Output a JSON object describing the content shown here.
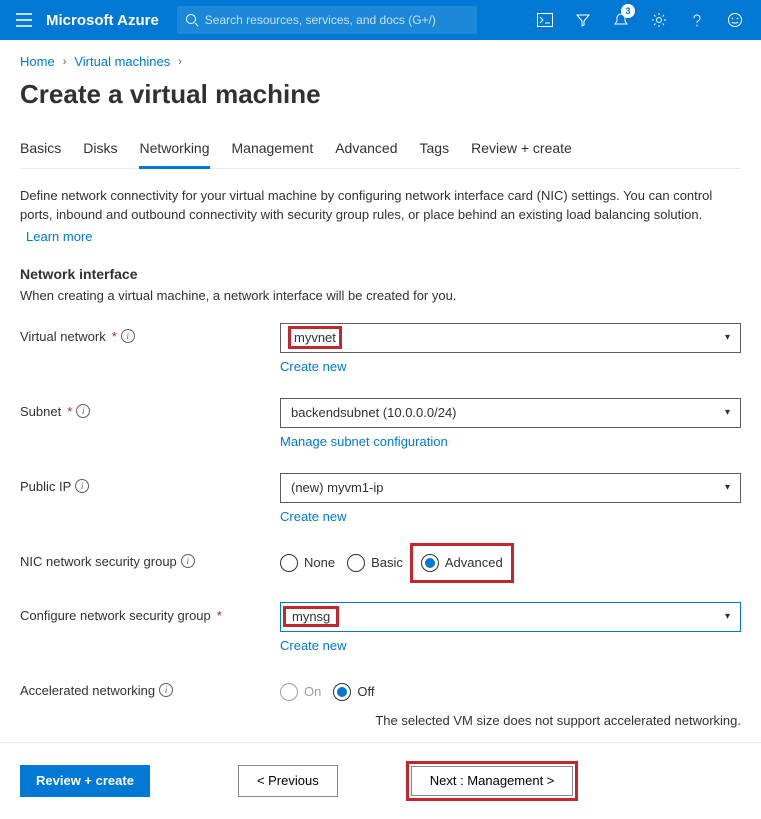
{
  "topbar": {
    "brand": "Microsoft Azure",
    "search_placeholder": "Search resources, services, and docs (G+/)",
    "notification_count": "3"
  },
  "breadcrumb": {
    "home": "Home",
    "vm": "Virtual machines"
  },
  "title": "Create a virtual machine",
  "tabs": {
    "basics": "Basics",
    "disks": "Disks",
    "networking": "Networking",
    "management": "Management",
    "advanced": "Advanced",
    "tags": "Tags",
    "review": "Review + create"
  },
  "description": "Define network connectivity for your virtual machine by configuring network interface card (NIC) settings. You can control ports, inbound and outbound connectivity with security group rules, or place behind an existing load balancing solution.",
  "learn_more": "Learn more",
  "section": {
    "heading": "Network interface",
    "sub": "When creating a virtual machine, a network interface will be created for you."
  },
  "fields": {
    "vnet": {
      "label": "Virtual network",
      "value": "myvnet",
      "create": "Create new"
    },
    "subnet": {
      "label": "Subnet",
      "value": "backendsubnet (10.0.0.0/24)",
      "manage": "Manage subnet configuration"
    },
    "pip": {
      "label": "Public IP",
      "value": "(new) myvm1-ip",
      "create": "Create new"
    },
    "nsg": {
      "label": "NIC network security group",
      "none": "None",
      "basic": "Basic",
      "advanced": "Advanced"
    },
    "cnsg": {
      "label": "Configure network security group",
      "value": "mynsg",
      "create": "Create new"
    },
    "accel": {
      "label": "Accelerated networking",
      "on": "On",
      "off": "Off",
      "note": "The selected VM size does not support accelerated networking."
    }
  },
  "footer": {
    "review": "Review + create",
    "prev": "<  Previous",
    "next": "Next : Management  >"
  }
}
